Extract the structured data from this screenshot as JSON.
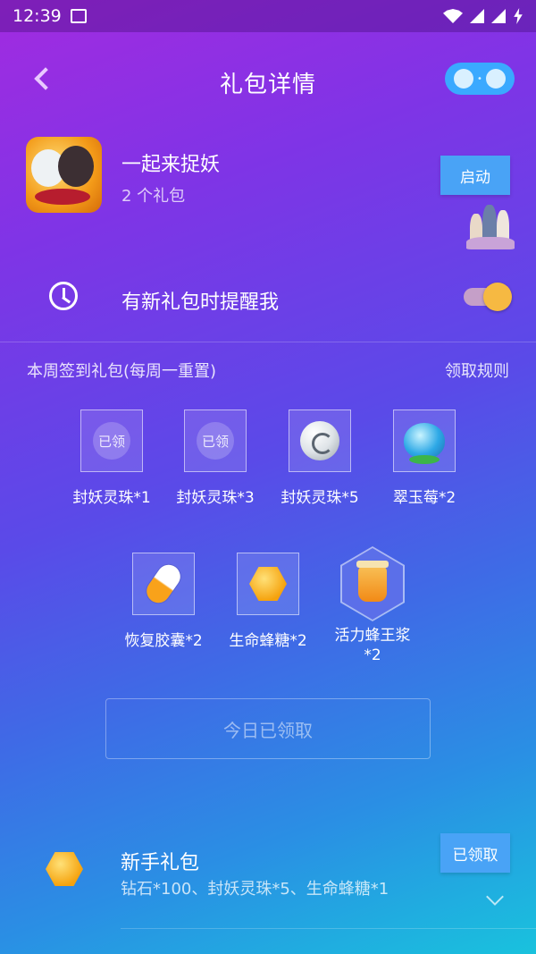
{
  "status_bar": {
    "time": "12:39"
  },
  "header": {
    "title": "礼包详情"
  },
  "game": {
    "name": "一起来捉妖",
    "gift_count": "2 个礼包",
    "launch_label": "启动"
  },
  "reminder": {
    "label": "有新礼包时提醒我",
    "enabled": true
  },
  "weekly": {
    "title": "本周签到礼包(每周一重置)",
    "rules_label": "领取规则",
    "claimed_badge": "已领",
    "items": [
      {
        "label": "封妖灵珠*1",
        "claimed": true
      },
      {
        "label": "封妖灵珠*3",
        "claimed": true
      },
      {
        "label": "封妖灵珠*5",
        "icon": "pearl-icon"
      },
      {
        "label": "翠玉莓*2",
        "icon": "berry-icon"
      },
      {
        "label": "恢复胶囊*2",
        "icon": "capsule-icon"
      },
      {
        "label": "生命蜂糖*2",
        "icon": "honey-icon"
      },
      {
        "label": "活力蜂王浆*2",
        "icon": "jar-icon"
      }
    ],
    "claimed_today_label": "今日已领取"
  },
  "newbie": {
    "title": "新手礼包",
    "content": "钻石*100、封妖灵珠*5、生命蜂糖*1",
    "claimed_label": "已领取"
  }
}
